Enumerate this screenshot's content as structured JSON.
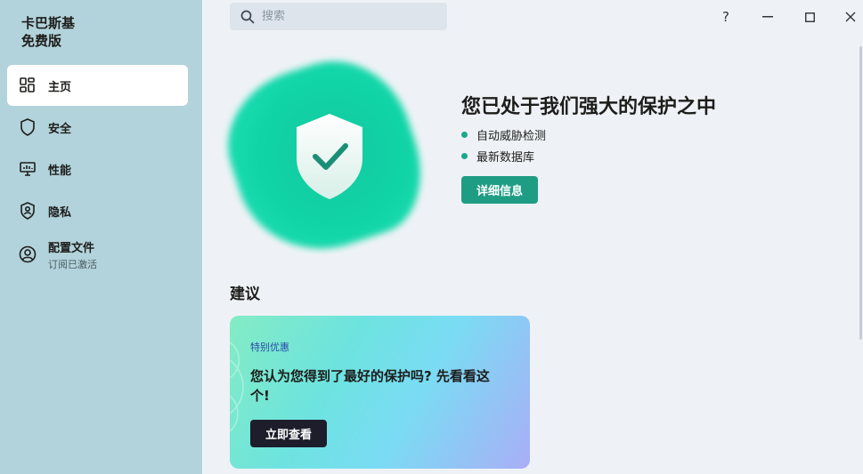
{
  "app": {
    "name_line1": "卡巴斯基",
    "name_line2": "免费版"
  },
  "sidebar": {
    "items": [
      {
        "label": "主页",
        "icon": "home-grid-icon",
        "active": true
      },
      {
        "label": "安全",
        "icon": "shield-icon",
        "active": false
      },
      {
        "label": "性能",
        "icon": "monitor-icon",
        "active": false
      },
      {
        "label": "隐私",
        "icon": "privacy-shield-icon",
        "active": false
      },
      {
        "label": "配置文件",
        "sublabel": "订阅已激活",
        "icon": "user-circle-icon",
        "active": false
      }
    ]
  },
  "search": {
    "placeholder": "搜索",
    "value": ""
  },
  "window_controls": {
    "help": "?",
    "minimize": "—",
    "maximize": "☐",
    "close": "✕"
  },
  "hero": {
    "title": "您已处于我们强大的保护之中",
    "bullets": [
      "自动威胁检测",
      "最新数据库"
    ],
    "button_label": "详细信息"
  },
  "recommendations": {
    "title": "建议",
    "card": {
      "tag": "特别优惠",
      "headline": "您认为您得到了最好的保护吗? 先看看这个!",
      "button_label": "立即查看"
    }
  },
  "colors": {
    "sidebar_bg": "#b2d3db",
    "content_bg": "#eef2f6",
    "accent_green": "#1f9d84",
    "blob_green": "#10d4a6"
  }
}
